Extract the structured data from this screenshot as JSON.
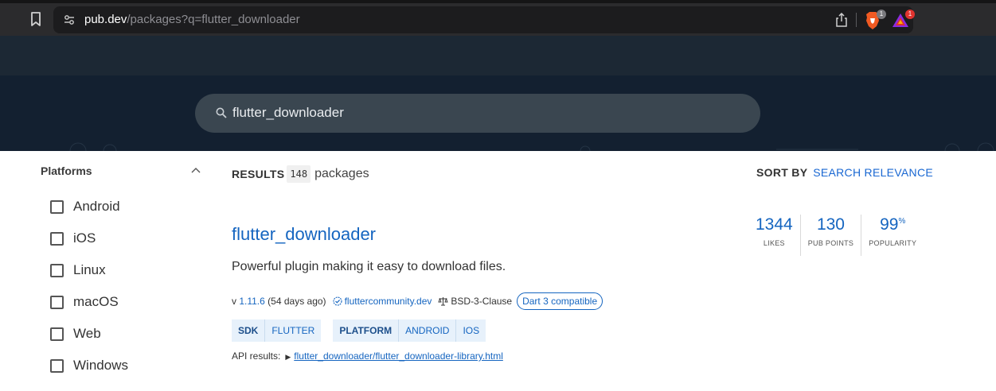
{
  "browser": {
    "url_host": "pub.dev",
    "url_path": "/packages?q=flutter_downloader",
    "brave_badge": "1",
    "extension_badge": "1"
  },
  "search": {
    "query": "flutter_downloader"
  },
  "sidebar": {
    "title": "Platforms",
    "items": [
      {
        "label": "Android",
        "checked": false
      },
      {
        "label": "iOS",
        "checked": false
      },
      {
        "label": "Linux",
        "checked": false
      },
      {
        "label": "macOS",
        "checked": false
      },
      {
        "label": "Web",
        "checked": false
      },
      {
        "label": "Windows",
        "checked": false
      }
    ]
  },
  "results": {
    "label": "RESULTS",
    "count": "148",
    "unit": "packages",
    "sort_label": "SORT BY",
    "sort_value": "SEARCH RELEVANCE"
  },
  "package": {
    "name": "flutter_downloader",
    "description": "Powerful plugin making it easy to download files.",
    "version_prefix": "v",
    "version": "1.11.6",
    "age": "(54 days ago)",
    "publisher": "fluttercommunity.dev",
    "license": "BSD-3-Clause",
    "dart3_badge": "Dart 3 compatible",
    "tag_groups": [
      {
        "key": "SDK",
        "values": [
          "FLUTTER"
        ]
      },
      {
        "key": "PLATFORM",
        "values": [
          "ANDROID",
          "IOS"
        ]
      }
    ],
    "api_label": "API results:",
    "api_link": "flutter_downloader/flutter_downloader-library.html",
    "scores": [
      {
        "value": "1344",
        "suffix": "",
        "label": "LIKES"
      },
      {
        "value": "130",
        "suffix": "",
        "label": "PUB POINTS"
      },
      {
        "value": "99",
        "suffix": "%",
        "label": "POPULARITY"
      }
    ]
  },
  "colors": {
    "link": "#1565c0",
    "banner": "#132030",
    "header": "#1c2834"
  }
}
